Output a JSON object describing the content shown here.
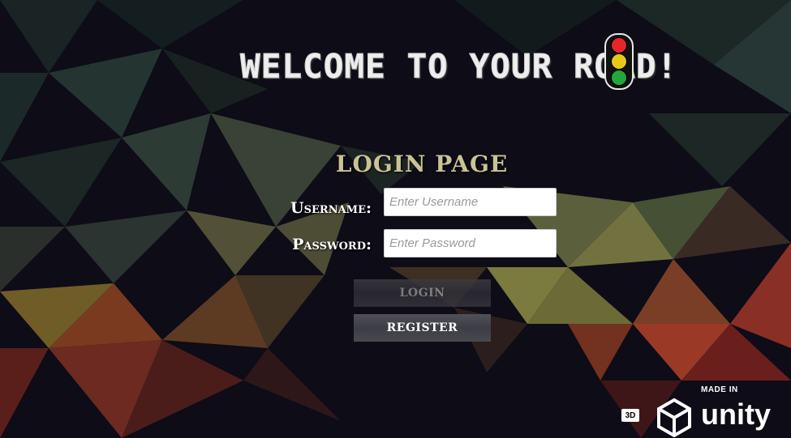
{
  "title": "WELCOME TO YOUR ROAD!",
  "traffic_light": {
    "icon": "traffic-light-icon",
    "colors": [
      "#e8262a",
      "#e6c81a",
      "#22a83a"
    ]
  },
  "login": {
    "heading": "LOGIN PAGE",
    "username_label": "Username:",
    "username_placeholder": "Enter Username",
    "password_label": "Password:",
    "password_placeholder": "Enter Password",
    "login_button": "LOGIN",
    "register_button": "REGISTER"
  },
  "branding": {
    "badge": "3D",
    "made_in": "MADE IN",
    "wordmark": "unity",
    "icon": "unity-logo-icon"
  },
  "colors": {
    "heading": "#c9c396",
    "background": "#0c0b16"
  }
}
